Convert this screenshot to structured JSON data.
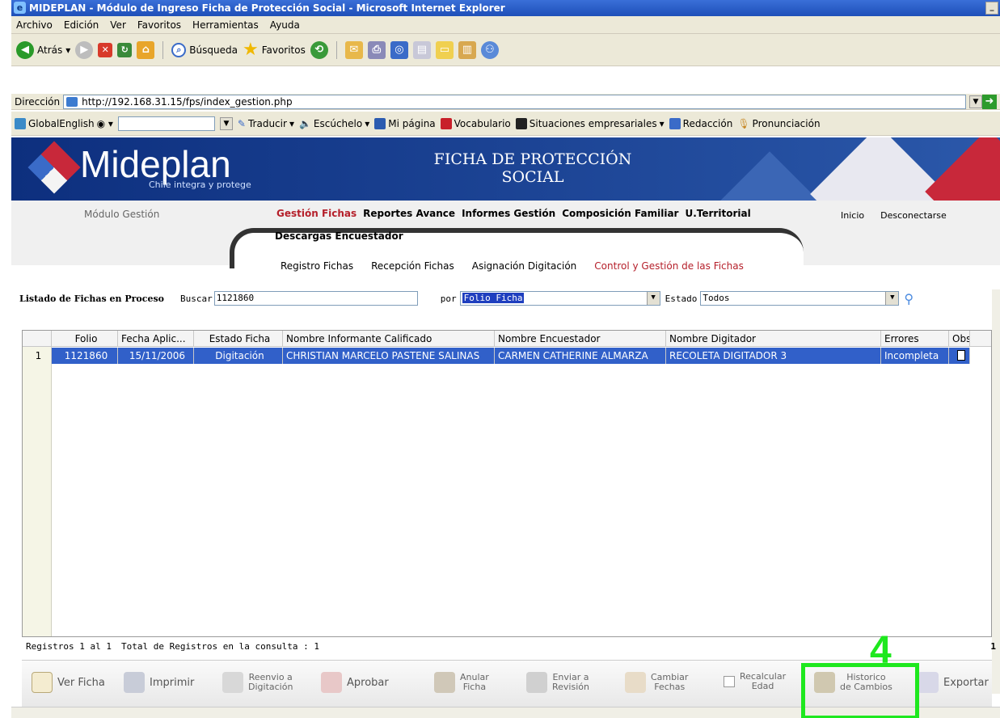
{
  "window": {
    "title": "MIDEPLAN - Módulo de Ingreso Ficha de Protección Social - Microsoft Internet Explorer"
  },
  "menubar": [
    "Archivo",
    "Edición",
    "Ver",
    "Favoritos",
    "Herramientas",
    "Ayuda"
  ],
  "toolbar": {
    "back": "Atrás",
    "search": "Búsqueda",
    "favorites": "Favoritos"
  },
  "address": {
    "label": "Dirección",
    "url": "http://192.168.31.15/fps/index_gestion.php"
  },
  "linksbar": {
    "globalenglish": "GlobalEnglish",
    "traducir": "Traducir",
    "escuchelo": "Escúchelo",
    "mipagina": "Mi página",
    "vocabulario": "Vocabulario",
    "situaciones": "Situaciones empresariales",
    "redaccion": "Redacción",
    "pronunciacion": "Pronunciación"
  },
  "banner": {
    "brand": "Mideplan",
    "tagline_a": "Chile",
    "tagline_b": "integra y protege",
    "title_line1": "FICHA DE PROTECCIÓN",
    "title_line2": "SOCIAL"
  },
  "nav": {
    "module": "Módulo Gestión",
    "top_links": [
      "Gestión Fichas",
      "Reportes Avance",
      "Informes Gestión",
      "Composición Familiar",
      "U.Territorial"
    ],
    "second_line": "Descargas Encuestador",
    "right_links": [
      "Inicio",
      "Desconectarse"
    ],
    "sub_links": [
      "Registro Fichas",
      "Recepción Fichas",
      "Asignación Digitación",
      "Control y Gestión de las Fichas"
    ]
  },
  "search": {
    "title": "Listado de Fichas en Proceso",
    "buscar_label": "Buscar",
    "buscar_value": "1121860",
    "por_label": "por",
    "por_value": "Folio Ficha",
    "estado_label": "Estado",
    "estado_value": "Todos"
  },
  "grid": {
    "columns": [
      "Folio",
      "Fecha Aplic...",
      "Estado Ficha",
      "Nombre Informante Calificado",
      "Nombre Encuestador",
      "Nombre Digitador",
      "Errores",
      "Obs"
    ],
    "rows": [
      {
        "num": "1",
        "folio": "1121860",
        "fecha": "15/11/2006",
        "estado": "Digitación",
        "informante": "CHRISTIAN MARCELO PASTENE SALINAS",
        "encuestador": "CARMEN CATHERINE ALMARZA",
        "digitador": "RECOLETA DIGITADOR 3",
        "errores": "Incompleta"
      }
    ]
  },
  "status": {
    "registros": "Registros 1 al 1",
    "total": "Total de Registros en la consulta : 1",
    "page": "1"
  },
  "actions": {
    "ver_ficha": "Ver Ficha",
    "imprimir": "Imprimir",
    "reenvio_1": "Reenvio a",
    "reenvio_2": "Digitación",
    "aprobar": "Aprobar",
    "anular_1": "Anular",
    "anular_2": "Ficha",
    "enviar_1": "Enviar a",
    "enviar_2": "Revisión",
    "cambiar_1": "Cambiar",
    "cambiar_2": "Fechas",
    "recalcular_1": "Recalcular",
    "recalcular_2": "Edad",
    "historico_1": "Historico",
    "historico_2": "de Cambios",
    "exportar": "Exportar"
  },
  "annotation": {
    "number": "4"
  }
}
